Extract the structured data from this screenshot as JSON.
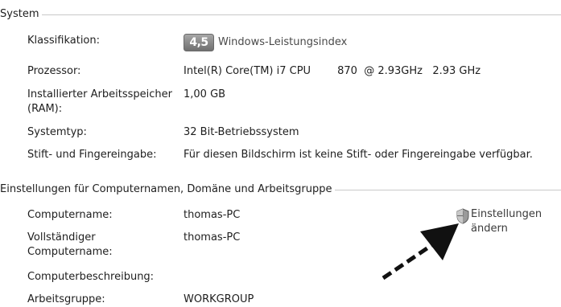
{
  "system": {
    "title": "System",
    "rating_label": "Klassifikation:",
    "rating_score": "4,5",
    "rating_link": "Windows-Leistungsindex",
    "processor_label": "Prozessor:",
    "processor_value": "Intel(R) Core(TM) i7 CPU        870  @ 2.93GHz   2.93 GHz",
    "ram_label": "Installierter Arbeitsspeicher (RAM):",
    "ram_value": "1,00 GB",
    "type_label": "Systemtyp:",
    "type_value": "32 Bit-Betriebssystem",
    "pen_label": "Stift- und Fingereingabe:",
    "pen_value": "Für diesen Bildschirm ist keine Stift- oder Fingereingabe verfügbar."
  },
  "computer": {
    "title": "Einstellungen für Computernamen, Domäne und Arbeitsgruppe",
    "name_label": "Computername:",
    "name_value": "thomas-PC",
    "fullname_label": "Vollständiger Computername:",
    "fullname_value": "thomas-PC",
    "description_label": "Computerbeschreibung:",
    "description_value": "",
    "workgroup_label": "Arbeitsgruppe:",
    "workgroup_value": "WORKGROUP",
    "change_settings_label": "Einstellungen ändern"
  },
  "colors": {
    "badge": "#8a8a8a",
    "rule": "#c9c9c9",
    "arrow": "#111111"
  },
  "icons": {
    "shield": "uac-shield-icon"
  }
}
